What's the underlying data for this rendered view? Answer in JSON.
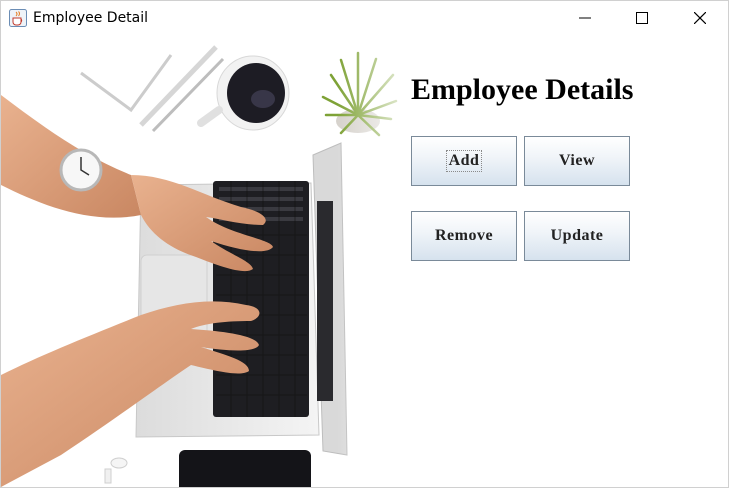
{
  "window": {
    "title": "Employee Detail",
    "icons": {
      "app": "java-cup-icon",
      "minimize": "minimize-icon",
      "maximize": "maximize-icon",
      "close": "close-icon"
    }
  },
  "main": {
    "heading": "Employee Details",
    "buttons": {
      "add": "Add",
      "view": "View",
      "remove": "Remove",
      "update": "Update"
    },
    "focused_button": "add"
  },
  "colors": {
    "button_border": "#7a8a99",
    "button_gradient_bottom": "#d6e2ee"
  }
}
